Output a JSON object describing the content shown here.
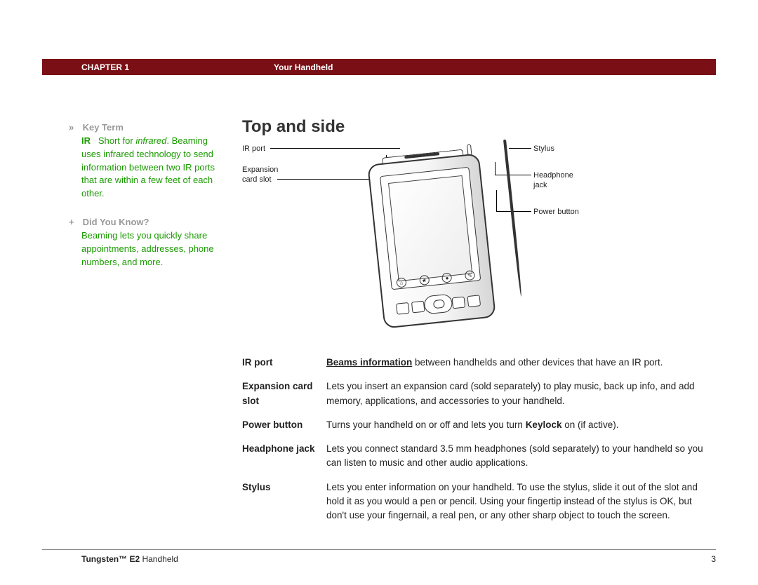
{
  "header": {
    "chapter": "CHAPTER 1",
    "title": "Your Handheld"
  },
  "sidebar": {
    "key_term": {
      "icon": "»",
      "heading": "Key Term",
      "ir_label": "IR",
      "ir_short": "Short for ",
      "ir_italic": "infrared",
      "ir_tail": ". Beaming uses infrared technology to send information between two IR ports that are within a few feet of each other."
    },
    "did_you_know": {
      "icon": "+",
      "heading": "Did You Know?",
      "body": "Beaming lets you quickly share appointments, addresses, phone numbers, and more."
    }
  },
  "main": {
    "heading": "Top and side",
    "callouts": {
      "ir_port": "IR port",
      "expansion_slot_l1": "Expansion",
      "expansion_slot_l2": "card slot",
      "stylus": "Stylus",
      "headphone_l1": "Headphone",
      "headphone_l2": "jack",
      "power_button": "Power button"
    },
    "definitions": [
      {
        "term": "IR port",
        "desc_link": "Beams information",
        "desc_rest": " between handhelds and other devices that have an IR port."
      },
      {
        "term": "Expansion card slot",
        "desc_rest": "Lets you insert an expansion card (sold separately) to play music, back up info, and add memory, applications, and accessories to your handheld."
      },
      {
        "term": "Power button",
        "desc_pre": "Turns your handheld on or off and lets you turn ",
        "desc_bold": "Keylock",
        "desc_post": " on (if active)."
      },
      {
        "term": "Headphone jack",
        "desc_rest": "Lets you connect standard 3.5 mm headphones (sold separately) to your handheld so you can listen to music and other audio applications."
      },
      {
        "term": "Stylus",
        "desc_rest": "Lets you enter information on your handheld. To use the stylus, slide it out of the slot and hold it as you would a pen or pencil. Using your fingertip instead of the stylus is OK, but don't use your fingernail, a real pen, or any other sharp object to touch the screen."
      }
    ]
  },
  "footer": {
    "product_bold": "Tungsten™ E2",
    "product_rest": " Handheld",
    "page_number": "3"
  }
}
